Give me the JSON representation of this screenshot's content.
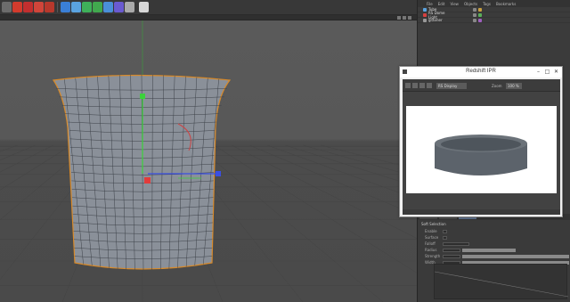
{
  "object_manager": {
    "menu": [
      "File",
      "Edit",
      "View",
      "Objects",
      "Tags",
      "Bookmarks"
    ],
    "objects": [
      {
        "name": "Tube"
      },
      {
        "name": "RS Dome Light"
      },
      {
        "name": "gravner"
      }
    ]
  },
  "attributes": {
    "section_title": "Soft Selection",
    "rows": [
      {
        "label": "Enable",
        "value": ""
      },
      {
        "label": "Surface",
        "value": ""
      },
      {
        "label": "Falloff",
        "value": ""
      },
      {
        "label": "Radius",
        "value": ""
      },
      {
        "label": "Strength",
        "value": ""
      },
      {
        "label": "Width",
        "value": ""
      }
    ]
  },
  "ipr": {
    "title": "Redshift IPR",
    "aov": "RS Display",
    "zoom_label": "Zoom",
    "zoom_value": "100 %",
    "minimize": "–",
    "maximize": "□",
    "close": "✕"
  },
  "colors": {
    "viewport_bg": "#585858",
    "mesh_fill": "#8a9099",
    "selection_outline": "#d88a2a",
    "axis_x": "#e23b3b",
    "axis_y": "#3bd23b",
    "axis_z": "#3b4fe2"
  }
}
